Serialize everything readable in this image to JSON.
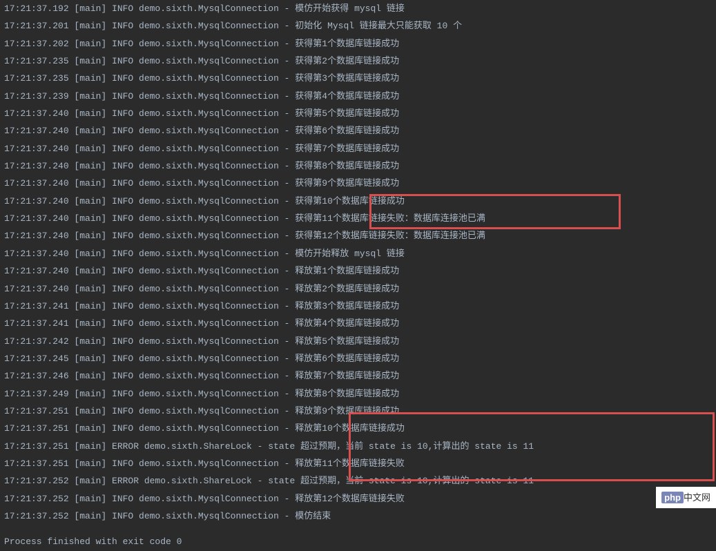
{
  "logs": [
    {
      "ts": "17:21:37.192",
      "thread": "[main]",
      "level": "INFO",
      "logger": "demo.sixth.MysqlConnection",
      "msg": "模仿开始获得 mysql 链接"
    },
    {
      "ts": "17:21:37.201",
      "thread": "[main]",
      "level": "INFO",
      "logger": "demo.sixth.MysqlConnection",
      "msg": "初始化 Mysql 链接最大只能获取 10 个"
    },
    {
      "ts": "17:21:37.202",
      "thread": "[main]",
      "level": "INFO",
      "logger": "demo.sixth.MysqlConnection",
      "msg": "获得第1个数据库链接成功"
    },
    {
      "ts": "17:21:37.235",
      "thread": "[main]",
      "level": "INFO",
      "logger": "demo.sixth.MysqlConnection",
      "msg": "获得第2个数据库链接成功"
    },
    {
      "ts": "17:21:37.235",
      "thread": "[main]",
      "level": "INFO",
      "logger": "demo.sixth.MysqlConnection",
      "msg": "获得第3个数据库链接成功"
    },
    {
      "ts": "17:21:37.239",
      "thread": "[main]",
      "level": "INFO",
      "logger": "demo.sixth.MysqlConnection",
      "msg": "获得第4个数据库链接成功"
    },
    {
      "ts": "17:21:37.240",
      "thread": "[main]",
      "level": "INFO",
      "logger": "demo.sixth.MysqlConnection",
      "msg": "获得第5个数据库链接成功"
    },
    {
      "ts": "17:21:37.240",
      "thread": "[main]",
      "level": "INFO",
      "logger": "demo.sixth.MysqlConnection",
      "msg": "获得第6个数据库链接成功"
    },
    {
      "ts": "17:21:37.240",
      "thread": "[main]",
      "level": "INFO",
      "logger": "demo.sixth.MysqlConnection",
      "msg": "获得第7个数据库链接成功"
    },
    {
      "ts": "17:21:37.240",
      "thread": "[main]",
      "level": "INFO",
      "logger": "demo.sixth.MysqlConnection",
      "msg": "获得第8个数据库链接成功"
    },
    {
      "ts": "17:21:37.240",
      "thread": "[main]",
      "level": "INFO",
      "logger": "demo.sixth.MysqlConnection",
      "msg": "获得第9个数据库链接成功"
    },
    {
      "ts": "17:21:37.240",
      "thread": "[main]",
      "level": "INFO",
      "logger": "demo.sixth.MysqlConnection",
      "msg": "获得第10个数据库链接成功"
    },
    {
      "ts": "17:21:37.240",
      "thread": "[main]",
      "level": "INFO",
      "logger": "demo.sixth.MysqlConnection",
      "msg": "获得第11个数据库链接失败：数据库连接池已满"
    },
    {
      "ts": "17:21:37.240",
      "thread": "[main]",
      "level": "INFO",
      "logger": "demo.sixth.MysqlConnection",
      "msg": "获得第12个数据库链接失败：数据库连接池已满"
    },
    {
      "ts": "17:21:37.240",
      "thread": "[main]",
      "level": "INFO",
      "logger": "demo.sixth.MysqlConnection",
      "msg": "模仿开始释放 mysql 链接"
    },
    {
      "ts": "17:21:37.240",
      "thread": "[main]",
      "level": "INFO",
      "logger": "demo.sixth.MysqlConnection",
      "msg": "释放第1个数据库链接成功"
    },
    {
      "ts": "17:21:37.240",
      "thread": "[main]",
      "level": "INFO",
      "logger": "demo.sixth.MysqlConnection",
      "msg": "释放第2个数据库链接成功"
    },
    {
      "ts": "17:21:37.241",
      "thread": "[main]",
      "level": "INFO",
      "logger": "demo.sixth.MysqlConnection",
      "msg": "释放第3个数据库链接成功"
    },
    {
      "ts": "17:21:37.241",
      "thread": "[main]",
      "level": "INFO",
      "logger": "demo.sixth.MysqlConnection",
      "msg": "释放第4个数据库链接成功"
    },
    {
      "ts": "17:21:37.242",
      "thread": "[main]",
      "level": "INFO",
      "logger": "demo.sixth.MysqlConnection",
      "msg": "释放第5个数据库链接成功"
    },
    {
      "ts": "17:21:37.245",
      "thread": "[main]",
      "level": "INFO",
      "logger": "demo.sixth.MysqlConnection",
      "msg": "释放第6个数据库链接成功"
    },
    {
      "ts": "17:21:37.246",
      "thread": "[main]",
      "level": "INFO",
      "logger": "demo.sixth.MysqlConnection",
      "msg": "释放第7个数据库链接成功"
    },
    {
      "ts": "17:21:37.249",
      "thread": "[main]",
      "level": "INFO",
      "logger": "demo.sixth.MysqlConnection",
      "msg": "释放第8个数据库链接成功"
    },
    {
      "ts": "17:21:37.251",
      "thread": "[main]",
      "level": "INFO",
      "logger": "demo.sixth.MysqlConnection",
      "msg": "释放第9个数据库链接成功"
    },
    {
      "ts": "17:21:37.251",
      "thread": "[main]",
      "level": "INFO",
      "logger": "demo.sixth.MysqlConnection",
      "msg": "释放第10个数据库链接成功"
    },
    {
      "ts": "17:21:37.251",
      "thread": "[main]",
      "level": "ERROR",
      "logger": "demo.sixth.ShareLock",
      "msg": "state 超过预期，当前 state is 10,计算出的 state is 11"
    },
    {
      "ts": "17:21:37.251",
      "thread": "[main]",
      "level": "INFO",
      "logger": "demo.sixth.MysqlConnection",
      "msg": "释放第11个数据库链接失败"
    },
    {
      "ts": "17:21:37.252",
      "thread": "[main]",
      "level": "ERROR",
      "logger": "demo.sixth.ShareLock",
      "msg": "state 超过预期，当前 state is 10,计算出的 state is 11"
    },
    {
      "ts": "17:21:37.252",
      "thread": "[main]",
      "level": "INFO",
      "logger": "demo.sixth.MysqlConnection",
      "msg": "释放第12个数据库链接失败"
    },
    {
      "ts": "17:21:37.252",
      "thread": "[main]",
      "level": "INFO",
      "logger": "demo.sixth.MysqlConnection",
      "msg": "模仿结束"
    }
  ],
  "process_line": "Process finished with exit code 0",
  "watermark": {
    "brand": "php",
    "suffix": "中文网"
  }
}
